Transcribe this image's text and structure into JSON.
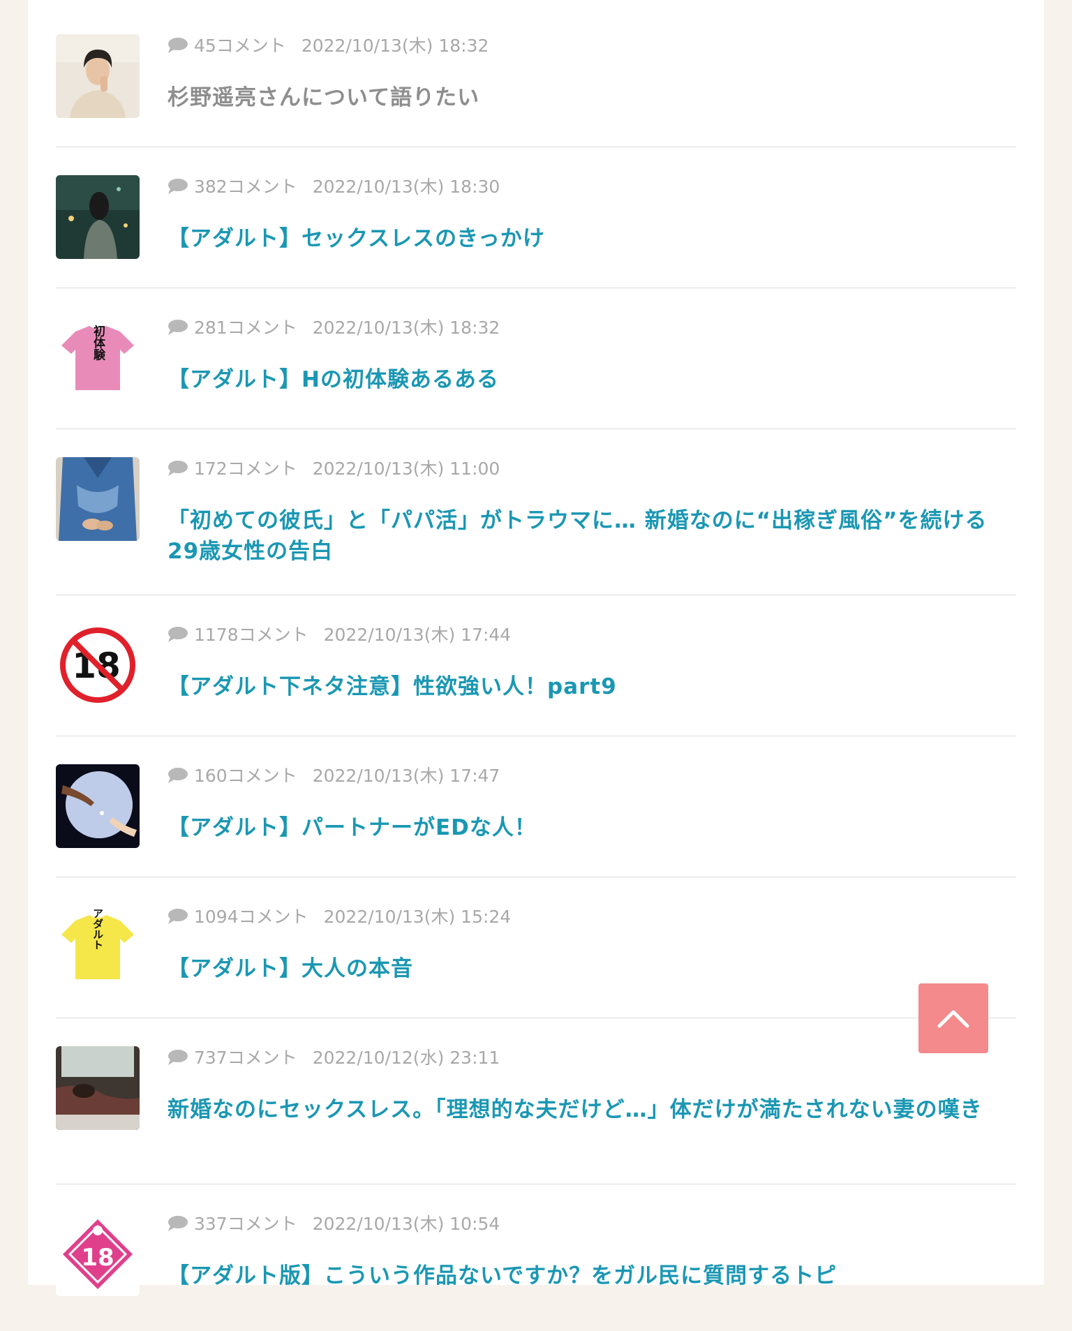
{
  "colors": {
    "background": "#f8f2ec",
    "panel": "#ffffff",
    "title_link": "#1a97b3",
    "title_visited": "#8e8e8e",
    "meta_text": "#a8a8a8",
    "divider": "#dcdcdc",
    "back_to_top": "#f48a8c"
  },
  "topics": [
    {
      "comments": "45コメント",
      "date": "2022/10/13(木) 18:32",
      "title": "杉野遥亮さんについて語りたい",
      "visited": true,
      "thumb": "thumb-person-portrait"
    },
    {
      "comments": "382コメント",
      "date": "2022/10/13(木) 18:30",
      "title": "【アダルト】セックスレスのきっかけ",
      "visited": false,
      "thumb": "thumb-night-woman"
    },
    {
      "comments": "281コメント",
      "date": "2022/10/13(木) 18:32",
      "title": "【アダルト】Hの初体験あるある",
      "visited": false,
      "thumb": "thumb-pink-tshirt"
    },
    {
      "comments": "172コメント",
      "date": "2022/10/13(木) 11:00",
      "title": "「初めての彼氏」と「パパ活」がトラウマに… 新婚なのに“出稼ぎ風俗”を続ける29歳女性の告白",
      "visited": false,
      "thumb": "thumb-blue-shirt"
    },
    {
      "comments": "1178コメント",
      "date": "2022/10/13(木) 17:44",
      "title": "【アダルト下ネタ注意】性欲強い人！part9",
      "visited": false,
      "thumb": "thumb-no-under-18"
    },
    {
      "comments": "160コメント",
      "date": "2022/10/13(木) 17:47",
      "title": "【アダルト】パートナーがEDな人！",
      "visited": false,
      "thumb": "thumb-moon-hands"
    },
    {
      "comments": "1094コメント",
      "date": "2022/10/13(木) 15:24",
      "title": "【アダルト】大人の本音",
      "visited": false,
      "thumb": "thumb-yellow-tshirt"
    },
    {
      "comments": "737コメント",
      "date": "2022/10/12(水) 23:11",
      "title": "新婚なのにセックスレス。「理想的な夫だけど…」体だけが満たされない妻の嘆き",
      "visited": false,
      "thumb": "thumb-bedroom"
    },
    {
      "comments": "337コメント",
      "date": "2022/10/13(木) 10:54",
      "title": "【アダルト版】こういう作品ないですか？をガル民に質問するトピ",
      "visited": false,
      "thumb": "thumb-pink-18-badge"
    }
  ],
  "thumb_text": {
    "pink_shirt": "初体験",
    "yellow_shirt": "アダルト",
    "no18": "18",
    "badge18": "18"
  },
  "back_to_top": {
    "icon": "chevron-up-icon"
  }
}
